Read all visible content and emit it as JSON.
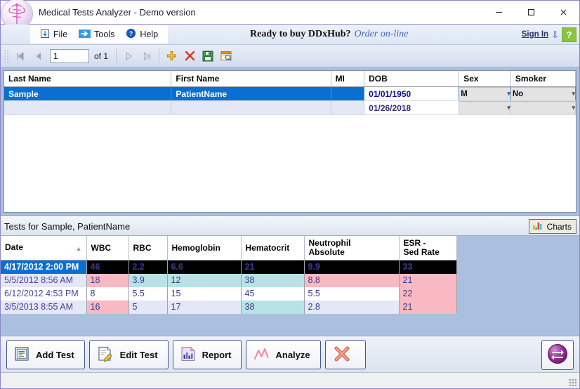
{
  "window": {
    "title": "Medical Tests Analyzer - Demo version",
    "logo_icon": "caduceus-icon",
    "minimize_label": "–",
    "maximize_label": "□",
    "close_label": "✕"
  },
  "menu": {
    "items": [
      {
        "label": "File",
        "icon": "file-import-icon"
      },
      {
        "label": "Tools",
        "icon": "blue-arrow-icon"
      },
      {
        "label": "Help",
        "icon": "help-question-icon"
      }
    ]
  },
  "promo": {
    "text": "Ready to buy DDxHub?",
    "link_label": "Order on-line",
    "sign_in_label": "Sign In",
    "download_icon": "download-arrow-icon",
    "help_button_label": "?",
    "help_button_color": "#8ac43f",
    "link_color": "#4a63b8"
  },
  "navigator": {
    "first_label": "◀❚",
    "prev_label": "◀",
    "page_value": "1",
    "page_placeholder": "1",
    "of_label": "of 1",
    "next_label": "▶",
    "last_label": "❚▶",
    "add_icon": "yellow-plus-icon",
    "delete_icon": "red-x-icon",
    "save_icon": "green-floppy-save-icon",
    "preview_icon": "print-preview-icon"
  },
  "patient_grid": {
    "columns": [
      "Last Name",
      "First Name",
      "MI",
      "DOB",
      "Sex",
      "Smoker"
    ],
    "rows": [
      {
        "selected": true,
        "last_name": "Sample",
        "first_name": "PatientName",
        "mi": "",
        "dob": "01/01/1950",
        "sex": "M",
        "smoker": "No"
      },
      {
        "selected": false,
        "last_name": "",
        "first_name": "",
        "mi": "",
        "dob": "01/26/2018",
        "sex": "",
        "smoker": ""
      }
    ],
    "selection_color": "#0b6fd1"
  },
  "tests_section": {
    "title": "Tests for Sample, PatientName",
    "charts_button_label": "Charts",
    "charts_icon": "bar-chart-icon",
    "sort_column": "Date",
    "sort_direction": "ascending",
    "columns": [
      "Date",
      "WBC",
      "RBC",
      "Hemoglobin",
      "Hematocrit",
      "Neutrophil Absolute",
      "ESR - Sed Rate"
    ],
    "column_lines": {
      "neutrophil_line1": "Neutrophil",
      "neutrophil_line2": "Absolute",
      "esr_line1": "ESR -",
      "esr_line2": "Sed Rate"
    },
    "rows": [
      {
        "selected": true,
        "date": "4/17/2012 2:00 PM",
        "cells": [
          {
            "value": "46",
            "flag": "high"
          },
          {
            "value": "2.2",
            "flag": "low"
          },
          {
            "value": "6.6",
            "flag": "low"
          },
          {
            "value": "21",
            "flag": "low"
          },
          {
            "value": "9.9",
            "flag": "high"
          },
          {
            "value": "33",
            "flag": "high"
          }
        ]
      },
      {
        "selected": false,
        "banded": true,
        "date": "5/5/2012 8:56 AM",
        "cells": [
          {
            "value": "18",
            "flag": "high"
          },
          {
            "value": "3.9",
            "flag": "low"
          },
          {
            "value": "12",
            "flag": "low"
          },
          {
            "value": "38",
            "flag": "low"
          },
          {
            "value": "8.8",
            "flag": "high"
          },
          {
            "value": "21",
            "flag": "high"
          }
        ]
      },
      {
        "selected": false,
        "banded": false,
        "date": "6/12/2012 4:53 PM",
        "cells": [
          {
            "value": "8",
            "flag": "normal"
          },
          {
            "value": "5.5",
            "flag": "normal"
          },
          {
            "value": "15",
            "flag": "normal"
          },
          {
            "value": "45",
            "flag": "normal"
          },
          {
            "value": "5.5",
            "flag": "normal"
          },
          {
            "value": "22",
            "flag": "high"
          }
        ]
      },
      {
        "selected": false,
        "banded": true,
        "date": "3/5/2013 8:55 AM",
        "cells": [
          {
            "value": "16",
            "flag": "high"
          },
          {
            "value": "5",
            "flag": "normal"
          },
          {
            "value": "17",
            "flag": "normal"
          },
          {
            "value": "38",
            "flag": "low"
          },
          {
            "value": "2.8",
            "flag": "normal"
          },
          {
            "value": "21",
            "flag": "high"
          }
        ]
      }
    ],
    "flag_colors": {
      "high": "#f9b9c3",
      "low": "#b7e3e6",
      "normal": "#ffffff",
      "selected_row_bg": "#000000",
      "selected_high_text": "#f08273",
      "selected_low_text": "#7ad3dd"
    }
  },
  "buttons": [
    {
      "label": "Add Test",
      "icon": "add-test-icon"
    },
    {
      "label": "Edit Test",
      "icon": "edit-test-icon"
    },
    {
      "label": "Report",
      "icon": "report-chart-icon"
    },
    {
      "label": "Analyze",
      "icon": "analyze-lightning-icon"
    },
    {
      "label": "",
      "icon": "delete-x-icon"
    }
  ],
  "swap_button": {
    "icon": "swap-arrows-icon",
    "label": ""
  },
  "theme": {
    "panel_blue": "#abc0de",
    "accent_blue": "#0b6fd1"
  }
}
